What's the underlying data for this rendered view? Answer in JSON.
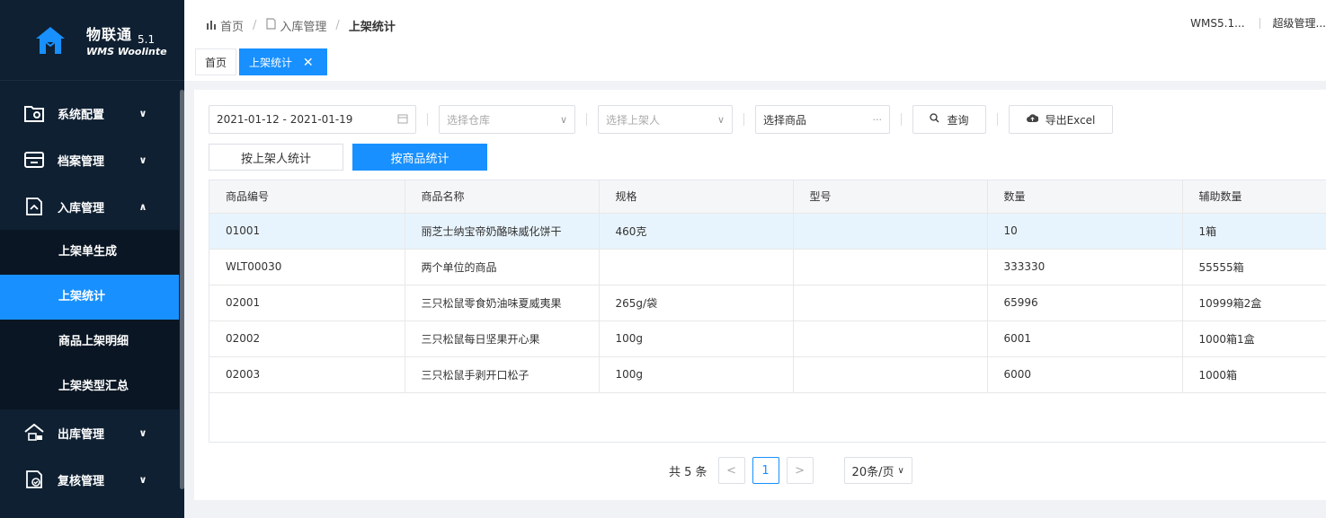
{
  "app": {
    "name": "物联通",
    "version": "5.1",
    "subtitle": "WMS Woolinte"
  },
  "sidebar": {
    "menu": [
      {
        "label": "系统配置",
        "icon": "settings-folder-icon",
        "expanded": false
      },
      {
        "label": "档案管理",
        "icon": "archive-icon",
        "expanded": false
      },
      {
        "label": "入库管理",
        "icon": "inbound-icon",
        "expanded": true
      },
      {
        "label": "出库管理",
        "icon": "outbound-icon",
        "expanded": false
      },
      {
        "label": "复核管理",
        "icon": "review-icon",
        "expanded": false
      }
    ],
    "submenu": [
      {
        "label": "上架单生成",
        "active": false
      },
      {
        "label": "上架统计",
        "active": true
      },
      {
        "label": "商品上架明细",
        "active": false
      },
      {
        "label": "上架类型汇总",
        "active": false
      }
    ]
  },
  "header": {
    "breadcrumb": {
      "home": "首页",
      "parent": "入库管理",
      "current": "上架统计",
      "sep": "/"
    },
    "system_label": "WMS5.1...",
    "user_label": "超级管理..."
  },
  "tabs": [
    {
      "label": "首页",
      "active": false
    },
    {
      "label": "上架统计",
      "active": true
    }
  ],
  "filters": {
    "date_range": "2021-01-12 - 2021-01-19",
    "warehouse_placeholder": "选择仓库",
    "operator_placeholder": "选择上架人",
    "product_placeholder": "选择商品",
    "more_symbol": "···",
    "query_label": "查询",
    "export_label": "导出Excel"
  },
  "toggles": {
    "by_operator": "按上架人统计",
    "by_product": "按商品统计"
  },
  "table": {
    "columns": [
      "商品编号",
      "商品名称",
      "规格",
      "型号",
      "数量",
      "辅助数量"
    ],
    "rows": [
      [
        "01001",
        "丽芝士纳宝帝奶酪味威化饼干",
        "460克",
        "",
        "10",
        "1箱"
      ],
      [
        "WLT00030",
        "两个单位的商品",
        "",
        "",
        "333330",
        "55555箱"
      ],
      [
        "02001",
        "三只松鼠零食奶油味夏威夷果",
        "265g/袋",
        "",
        "65996",
        "10999箱2盒"
      ],
      [
        "02002",
        "三只松鼠每日坚果开心果",
        "100g",
        "",
        "6001",
        "1000箱1盒"
      ],
      [
        "02003",
        "三只松鼠手剥开口松子",
        "100g",
        "",
        "6000",
        "1000箱"
      ]
    ]
  },
  "pagination": {
    "total_text": "共 5 条",
    "current_page": "1",
    "page_size": "20条/页",
    "prev": "<",
    "next": ">"
  },
  "colors": {
    "sidebar_bg": "#0f2032",
    "accent": "#1890ff",
    "highlight_row": "#e8f4fd"
  }
}
